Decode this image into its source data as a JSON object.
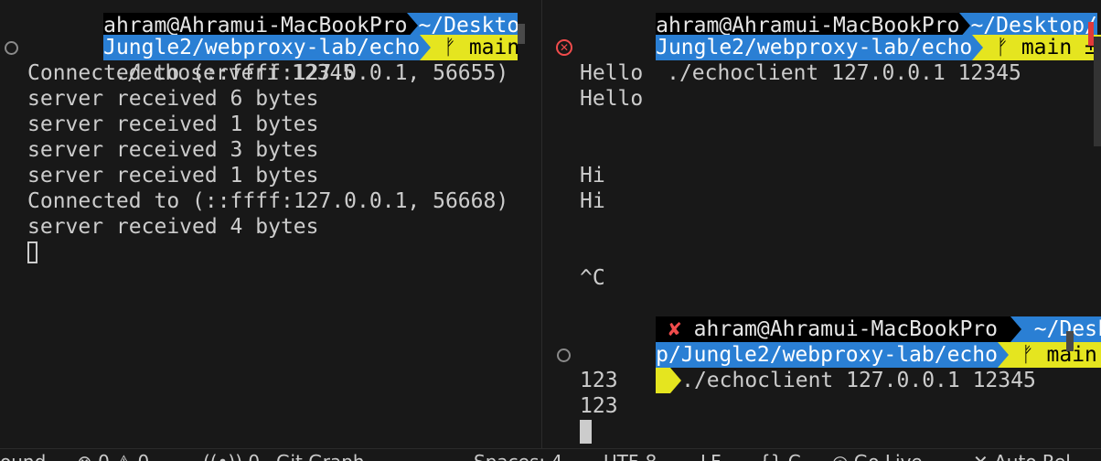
{
  "left_pane": {
    "prompt_top": {
      "user_host_partial": "ahram@Ahramui-MacBookPro",
      "path_partial": "~/Desktop/",
      "path_line2": "Jungle2/webproxy-lab/echo",
      "branch": "main ±"
    },
    "command": "./echoserveri 12345",
    "output": [
      "Connected to (::ffff:127.0.0.1, 56655)",
      "server received 6 bytes",
      "server received 1 bytes",
      "server received 3 bytes",
      "server received 1 bytes",
      "Connected to (::ffff:127.0.0.1, 56668)",
      "server received 4 bytes"
    ]
  },
  "right_pane": {
    "prompt_top": {
      "user_host_partial": "ahram@Ahramui-MacBookPro",
      "path_partial": "~/Desktop/",
      "path_line2": "Jungle2/webproxy-lab/echo",
      "branch": "main ±"
    },
    "command1": "./echoclient 127.0.0.1 12345",
    "session1": [
      "Hello",
      "Hello",
      "",
      "",
      "Hi",
      "Hi",
      "",
      "",
      "^C"
    ],
    "prompt2": {
      "error_mark": "✘",
      "user_host": "ahram@Ahramui-MacBookPro",
      "path_part1": "~/Deskto",
      "path_part2": "p/Jungle2/webproxy-lab/echo",
      "branch": "main ±"
    },
    "command2": "./echoclient 127.0.0.1 12345",
    "session2": [
      "123",
      "123"
    ]
  },
  "branch_glyph": "ᚠ",
  "statusbar": {
    "items": [
      "ound",
      "⊗ 0 ⚠ 0",
      "((•)) 0",
      "Git Graph",
      "Spaces: 4",
      "UTF-8",
      "LF",
      "{} C",
      "◎ Go Live",
      "✕ Auto Rel"
    ]
  },
  "colors": {
    "background": "#181818",
    "prompt_blue": "#2a7fd4",
    "prompt_yellow": "#e5e51f",
    "error_red": "#f14c4c"
  }
}
